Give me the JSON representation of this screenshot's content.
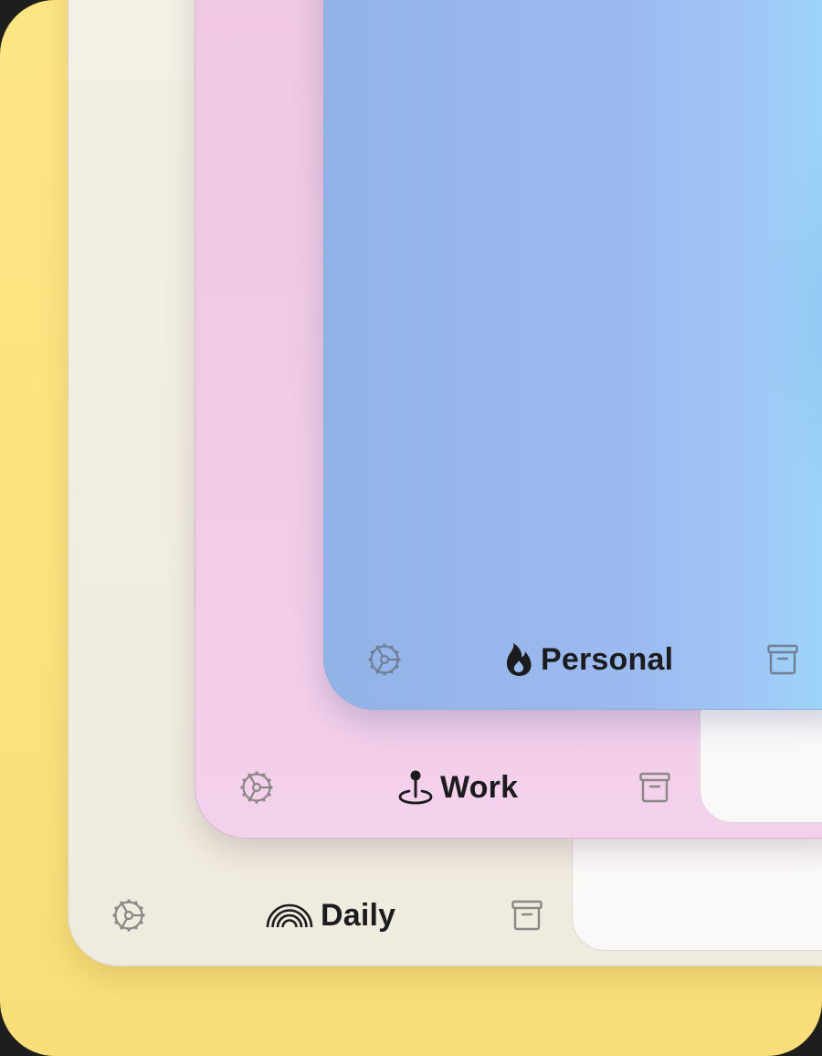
{
  "colors": {
    "yellow_base": "#fee584",
    "daily_card": "#f0ece0",
    "work_card": "#f0cae4",
    "personal_card_left": "#92b3e8",
    "personal_card_right": "#9ad5f9",
    "icon_gray": "#8a8784",
    "text_dark": "#1c1c1e"
  },
  "cards": {
    "daily": {
      "title": "Daily",
      "title_icon": "rainbow-icon",
      "left_icon": "gear-icon",
      "right_icon": "archive-box-icon"
    },
    "work": {
      "title": "Work",
      "title_icon": "map-pin-icon",
      "left_icon": "gear-icon",
      "right_icon": "archive-box-icon"
    },
    "personal": {
      "title": "Personal",
      "title_icon": "flame-icon",
      "left_icon": "gear-icon",
      "right_icon": "archive-box-icon"
    }
  }
}
